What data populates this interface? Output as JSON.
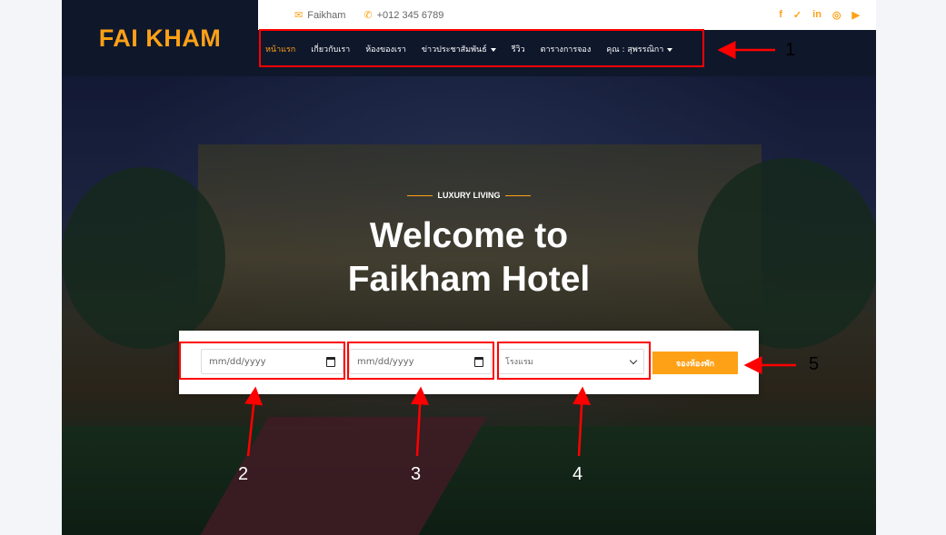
{
  "brand": {
    "name": "FAI KHAM"
  },
  "topbar": {
    "email_label": "Faikham",
    "phone": "+012 345 6789",
    "socials": [
      "f",
      "t",
      "in",
      "ig",
      "yt"
    ]
  },
  "nav": {
    "items": [
      {
        "label": "หน้าแรก",
        "active": true
      },
      {
        "label": "เกี่ยวกับเรา"
      },
      {
        "label": "ห้องของเรา"
      },
      {
        "label": "ข่าวประชาสัมพันธ์",
        "dropdown": true
      },
      {
        "label": "รีวิว"
      },
      {
        "label": "ตารางการจอง"
      },
      {
        "label": "คุณ : สุพรรณิกา",
        "dropdown": true
      }
    ]
  },
  "hero": {
    "kicker": "LUXURY LIVING",
    "title_line1": "Welcome to",
    "title_line2": "Faikham Hotel"
  },
  "booking": {
    "checkin_placeholder": "mm/dd/yyyy",
    "checkout_placeholder": "mm/dd/yyyy",
    "hotel_select_value": "โรงแรม",
    "book_button": "จองห้องพัก"
  },
  "annotations": [
    "1",
    "2",
    "3",
    "4",
    "5"
  ],
  "colors": {
    "accent": "#fea116",
    "navy": "#0f172b",
    "annotation": "#ff0000"
  }
}
